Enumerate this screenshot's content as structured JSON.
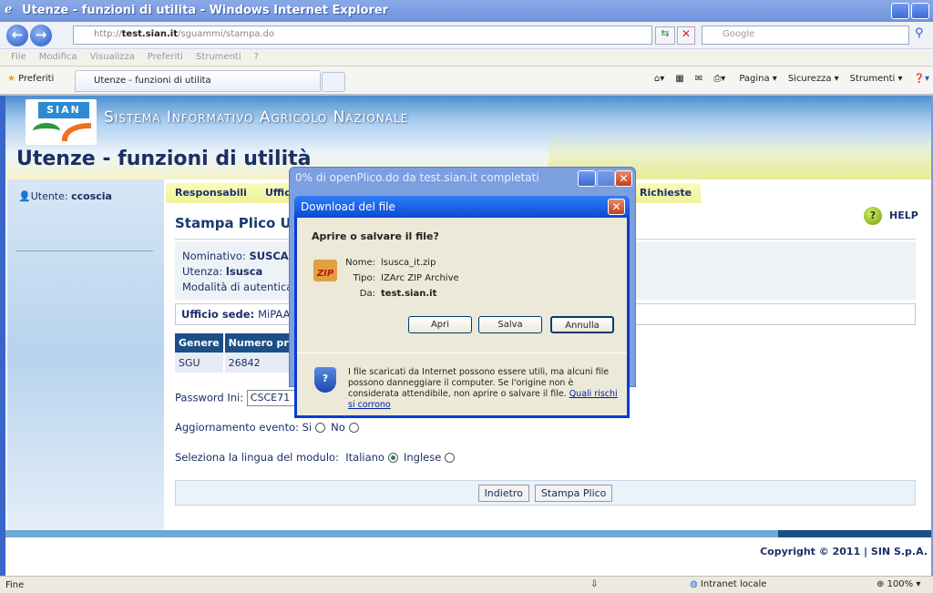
{
  "browser": {
    "title": "Utenze - funzioni di utilita - Windows Internet Explorer",
    "url_prefix": "http://",
    "url_host": "test.sian.it",
    "url_path": "/sguammi/stampa.do",
    "search_placeholder": "Google",
    "menu": [
      "File",
      "Modifica",
      "Visualizza",
      "Preferiti",
      "Strumenti",
      "?"
    ],
    "favorites": "Preferiti",
    "tab_label": "Utenze - funzioni di utilita",
    "tools": [
      "Pagina ▾",
      "Sicurezza ▾",
      "Strumenti ▾"
    ],
    "status_left": "Fine",
    "zone": "Intranet locale",
    "zoom": "100%"
  },
  "page": {
    "logo": "SIAN",
    "site_name": "Sistema Informativo Agricolo Nazionale",
    "title": "Utenze - funzioni di utilità",
    "user_label": "Utente: ",
    "user": "ccoscia",
    "tabs": [
      "Responsabili",
      "Uffic",
      "Richieste"
    ],
    "heading": "Stampa Plico Ut",
    "help": "HELP",
    "nominativo_label": "Nominativo: ",
    "nominativo": "SUSCA",
    "utenza_label": "Utenza: ",
    "utenza": "lsusca",
    "modalita": "Modalità di autentica",
    "ufficio_label": "Ufficio sede: ",
    "ufficio": "MiPAAF",
    "table": {
      "headers": [
        "Genere",
        "Numero pra"
      ],
      "rows": [
        [
          "SGU",
          "26842"
        ]
      ]
    },
    "password_label": "Password Ini:",
    "password": "CSCE71",
    "aggiornamento_label": "Aggiornamento evento:",
    "si": "Si",
    "no": "No",
    "lingua_label": "Seleziona la lingua del modulo:",
    "italiano": "Italiano",
    "inglese": "Inglese",
    "lingua_selected": "Italiano",
    "back": "Indietro",
    "print": "Stampa Plico",
    "copyright": "Copyright © 2011 | SIN S.p.A."
  },
  "progress": {
    "title": "0% di openPlico.do da test.sian.it completati"
  },
  "dialog": {
    "title": "Download del file",
    "question": "Aprire o salvare il file?",
    "name_label": "Nome:",
    "name": "lsusca_it.zip",
    "type_label": "Tipo:",
    "type": "IZArc ZIP Archive",
    "from_label": "Da:",
    "from": "test.sian.it",
    "open": "Apri",
    "save": "Salva",
    "cancel": "Annulla",
    "warning": "I file scaricati da Internet possono essere utili, ma alcuni file possono danneggiare il computer. Se l'origine non è considerata attendibile, non aprire o salvare il file. ",
    "risk_link": "Quali rischi si corrono"
  }
}
